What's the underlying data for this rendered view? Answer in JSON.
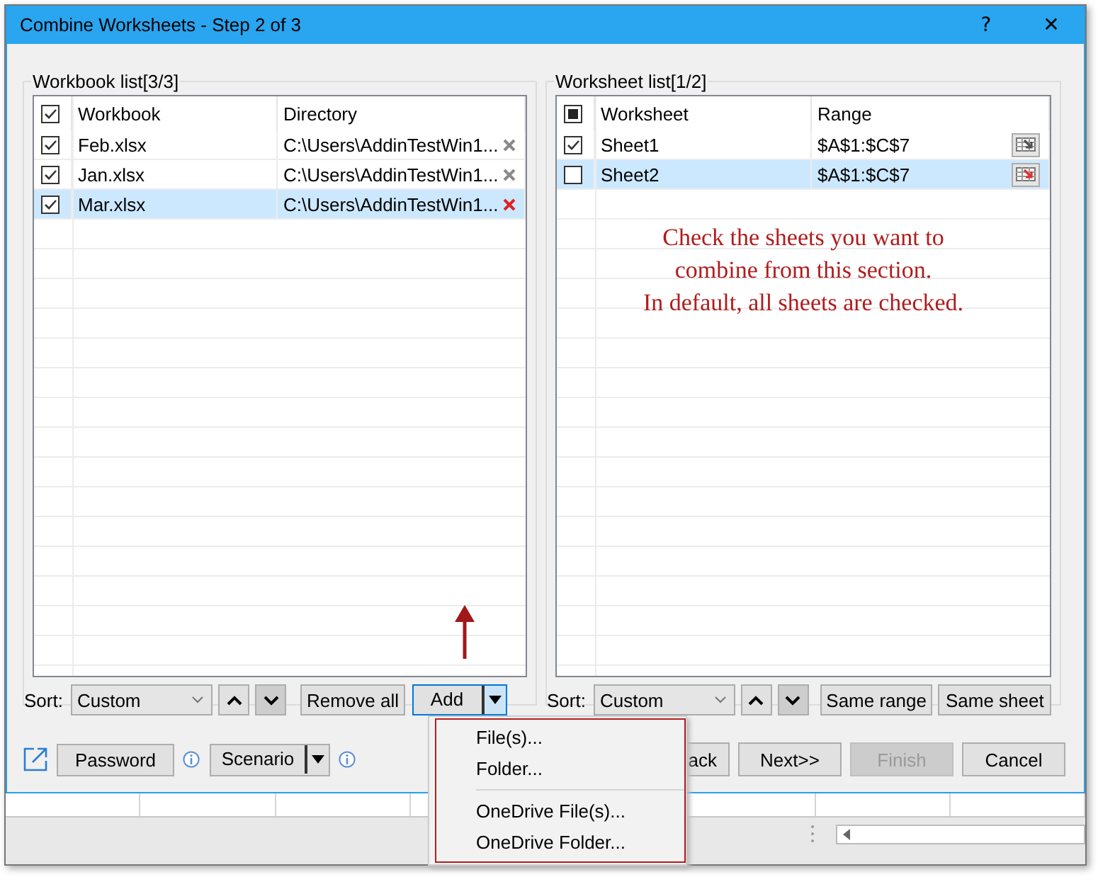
{
  "window": {
    "title": "Combine Worksheets - Step 2 of 3",
    "help": "?",
    "close": "✕"
  },
  "workbook_list": {
    "legend": "Workbook list[3/3]",
    "header_checked": true,
    "columns": [
      "Workbook",
      "Directory"
    ],
    "rows": [
      {
        "checked": true,
        "name": "Feb.xlsx",
        "directory": "C:\\Users\\AddinTestWin1...",
        "selected": false
      },
      {
        "checked": true,
        "name": "Jan.xlsx",
        "directory": "C:\\Users\\AddinTestWin1...",
        "selected": false
      },
      {
        "checked": true,
        "name": "Mar.xlsx",
        "directory": "C:\\Users\\AddinTestWin1...",
        "selected": true
      }
    ],
    "sort_label": "Sort:",
    "sort_value": "Custom",
    "remove_all": "Remove all",
    "add": "Add"
  },
  "worksheet_list": {
    "legend": "Worksheet list[1/2]",
    "header_mixed": true,
    "columns": [
      "Worksheet",
      "Range"
    ],
    "rows": [
      {
        "checked": true,
        "name": "Sheet1",
        "range": "$A$1:$C$7",
        "selected": false
      },
      {
        "checked": false,
        "name": "Sheet2",
        "range": "$A$1:$C$7",
        "selected": true
      }
    ],
    "note": "Check the sheets you want to\ncombine from this section.\nIn default, all sheets are checked.",
    "sort_label": "Sort:",
    "sort_value": "Custom",
    "buttons": [
      "Same range",
      "Same sheet"
    ]
  },
  "footer": {
    "password": "Password",
    "scenario": "Scenario",
    "buttons": [
      {
        "label": "ack",
        "disabled": false
      },
      {
        "label": "Next>>",
        "disabled": false
      },
      {
        "label": "Finish",
        "disabled": true
      },
      {
        "label": "Cancel",
        "disabled": false
      }
    ]
  },
  "add_menu": [
    {
      "kind": "item",
      "label": "File(s)..."
    },
    {
      "kind": "item",
      "label": "Folder..."
    },
    {
      "kind": "separator"
    },
    {
      "kind": "item",
      "label": "OneDrive File(s)..."
    },
    {
      "kind": "item",
      "label": "OneDrive Folder..."
    }
  ]
}
